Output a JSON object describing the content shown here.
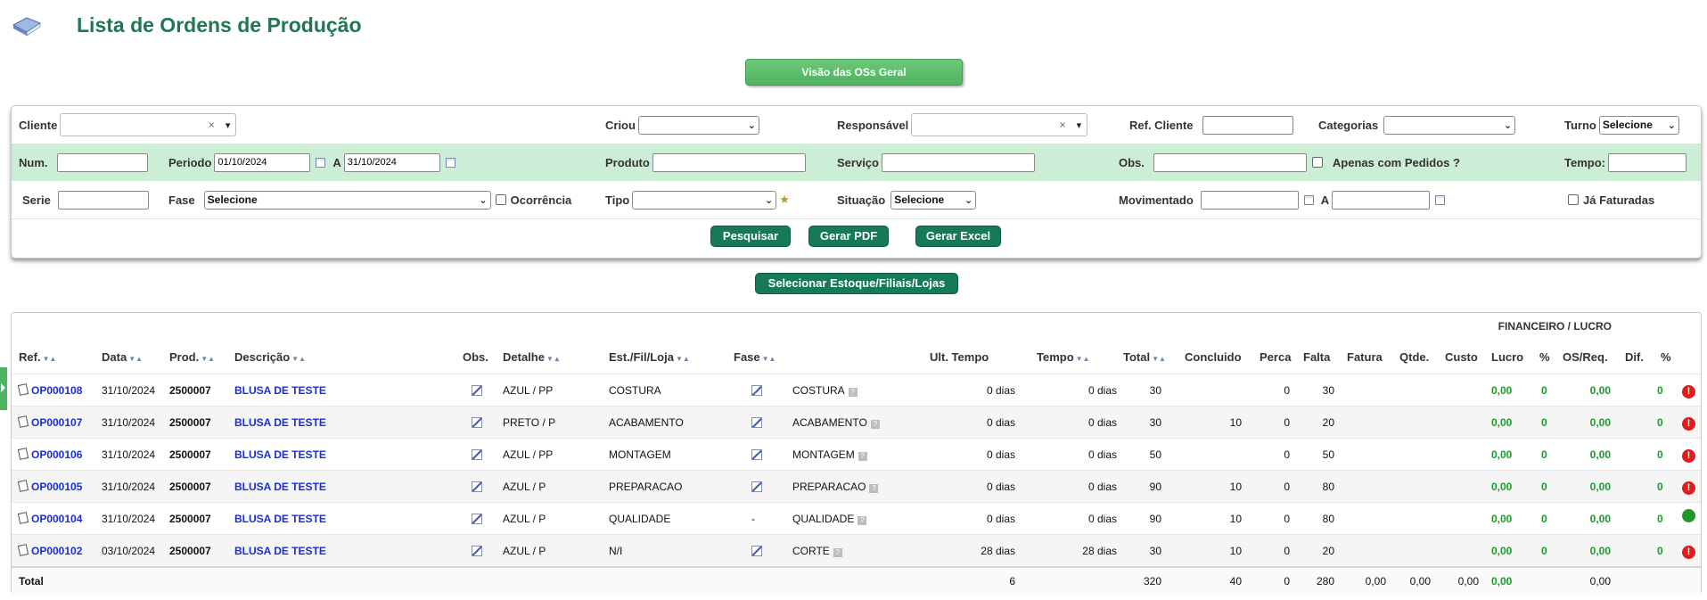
{
  "header": {
    "title": "Lista de Ordens de Produção",
    "logo_icon": "book-icon"
  },
  "visao_button": "Visão das OSs Geral",
  "filters": {
    "cliente": "Cliente",
    "criou": "Criou",
    "responsavel": "Responsável",
    "ref_cliente": "Ref. Cliente",
    "categorias": "Categorias",
    "turno": "Turno",
    "turno_value": "Selecione",
    "num": "Num.",
    "periodo": "Periodo",
    "periodo_from": "01/10/2024",
    "a": "A",
    "periodo_to": "31/10/2024",
    "produto": "Produto",
    "servico": "Serviço",
    "obs": "Obs.",
    "apenas_pedidos": "Apenas com Pedidos ?",
    "tempo": "Tempo:",
    "serie": "Serie",
    "fase": "Fase",
    "fase_value": "Selecione",
    "ocorrencia": "Ocorrência",
    "tipo": "Tipo",
    "situacao": "Situação",
    "situacao_value": "Selecione",
    "movimentado": "Movimentado",
    "ja_faturadas": "Já Faturadas",
    "clear_symbol": "×"
  },
  "actions": {
    "pesquisar": "Pesquisar",
    "gerar_pdf": "Gerar PDF",
    "gerar_excel": "Gerar Excel"
  },
  "estoque_button": "Selecionar Estoque/Filiais/Lojas",
  "table": {
    "financeiro_label": "FINANCEIRO / LUCRO",
    "columns": {
      "ref": "Ref.",
      "data": "Data",
      "prod": "Prod.",
      "descricao": "Descrição",
      "obs": "Obs.",
      "detalhe": "Detalhe",
      "est": "Est./Fil/Loja",
      "fase": "Fase",
      "ult_tempo": "Ult. Tempo",
      "tempo": "Tempo",
      "total": "Total",
      "concluido": "Concluido",
      "perca": "Perca",
      "falta": "Falta",
      "fatura": "Fatura",
      "qtde": "Qtde.",
      "custo": "Custo",
      "lucro": "Lucro",
      "pct": "%",
      "osreq": "OS/Req.",
      "dif": "Dif.",
      "pct2": "%"
    },
    "rows": [
      {
        "ref": "OP000108",
        "data": "31/10/2024",
        "prod": "2500007",
        "desc": "BLUSA DE TESTE",
        "detalhe": "AZUL / PP",
        "est": "COSTURA",
        "fase_mark": "",
        "fase": "COSTURA",
        "ult_tempo": "0 dias",
        "tempo": "0 dias",
        "total": "30",
        "concluido": "",
        "perca": "0",
        "falta": "30",
        "lucro": "0,00",
        "pct": "0",
        "dif": "0,00",
        "pct2": "0",
        "status": "alert"
      },
      {
        "ref": "OP000107",
        "data": "31/10/2024",
        "prod": "2500007",
        "desc": "BLUSA DE TESTE",
        "detalhe": "PRETO / P",
        "est": "ACABAMENTO",
        "fase_mark": "",
        "fase": "ACABAMENTO",
        "ult_tempo": "0 dias",
        "tempo": "0 dias",
        "total": "30",
        "concluido": "10",
        "perca": "0",
        "falta": "20",
        "lucro": "0,00",
        "pct": "0",
        "dif": "0,00",
        "pct2": "0",
        "status": "alert"
      },
      {
        "ref": "OP000106",
        "data": "31/10/2024",
        "prod": "2500007",
        "desc": "BLUSA DE TESTE",
        "detalhe": "AZUL / PP",
        "est": "MONTAGEM",
        "fase_mark": "",
        "fase": "MONTAGEM",
        "ult_tempo": "0 dias",
        "tempo": "0 dias",
        "total": "50",
        "concluido": "",
        "perca": "0",
        "falta": "50",
        "lucro": "0,00",
        "pct": "0",
        "dif": "0,00",
        "pct2": "0",
        "status": "alert"
      },
      {
        "ref": "OP000105",
        "data": "31/10/2024",
        "prod": "2500007",
        "desc": "BLUSA DE TESTE",
        "detalhe": "AZUL / P",
        "est": "PREPARACAO",
        "fase_mark": "",
        "fase": "PREPARACAO",
        "ult_tempo": "0 dias",
        "tempo": "0 dias",
        "total": "90",
        "concluido": "10",
        "perca": "0",
        "falta": "80",
        "lucro": "0,00",
        "pct": "0",
        "dif": "0,00",
        "pct2": "0",
        "status": "alert"
      },
      {
        "ref": "OP000104",
        "data": "31/10/2024",
        "prod": "2500007",
        "desc": "BLUSA DE TESTE",
        "detalhe": "AZUL / P",
        "est": "QUALIDADE",
        "fase_mark": "-",
        "fase": "QUALIDADE",
        "ult_tempo": "0 dias",
        "tempo": "0 dias",
        "total": "90",
        "concluido": "10",
        "perca": "0",
        "falta": "80",
        "lucro": "0,00",
        "pct": "0",
        "dif": "0,00",
        "pct2": "0",
        "status": "ok"
      },
      {
        "ref": "OP000102",
        "data": "03/10/2024",
        "prod": "2500007",
        "desc": "BLUSA DE TESTE",
        "detalhe": "AZUL / P",
        "est": "N/I",
        "fase_mark": "",
        "fase": "CORTE",
        "ult_tempo": "28 dias",
        "tempo": "28 dias",
        "total": "30",
        "concluido": "10",
        "perca": "0",
        "falta": "20",
        "lucro": "0,00",
        "pct": "0",
        "dif": "0,00",
        "pct2": "0",
        "status": "alert"
      }
    ],
    "totals": {
      "label": "Total",
      "ult_tempo": "6",
      "total": "320",
      "concluido": "40",
      "perca": "0",
      "falta": "280",
      "fatura": "0,00",
      "qtde": "0,00",
      "custo": "0,00",
      "lucro": "0,00",
      "dif": "0,00"
    },
    "alert_symbol": "!",
    "help_symbol": "?",
    "colors": {
      "green": "#1d9a2a",
      "alert": "#e21b1b",
      "title": "#1e7850"
    }
  }
}
